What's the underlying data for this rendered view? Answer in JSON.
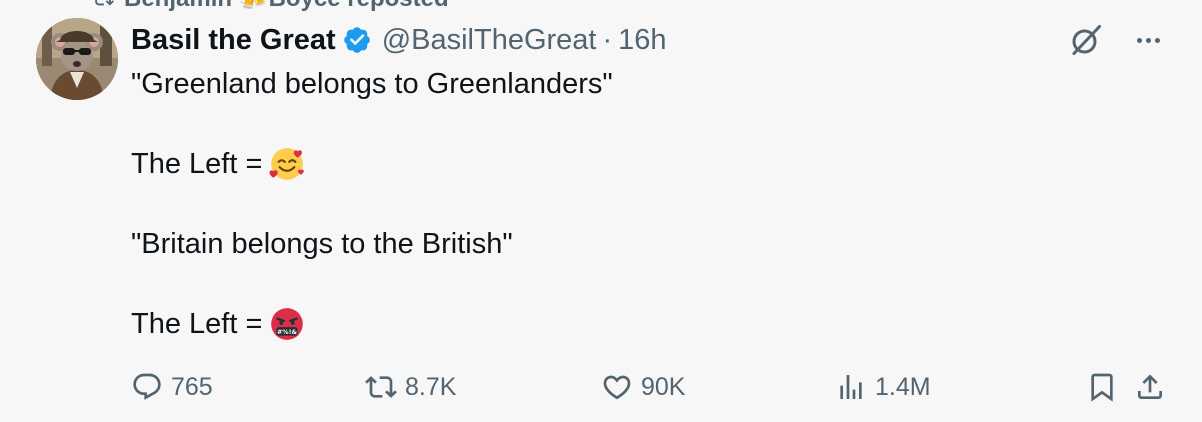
{
  "repost": {
    "text": "Benjamin 🍻Boyce reposted",
    "icon": "repost-icon"
  },
  "tweet": {
    "author_name": "Basil the Great",
    "handle": "@BasilTheGreat",
    "separator": "·",
    "time": "16h",
    "verified": true,
    "verified_color": "#1d9bf0",
    "lines": [
      "\"Greenland belongs to Greenlanders\"",
      "",
      "The Left =",
      "",
      "\"Britain belongs to the British\"",
      "",
      "The Left ="
    ],
    "emojis": [
      "smiling-face-with-hearts-emoji",
      "face-with-symbols-on-mouth-emoji"
    ]
  },
  "actions": {
    "replies": "765",
    "reposts": "8.7K",
    "likes": "90K",
    "views": "1.4M"
  },
  "colors": {
    "text": "#0f1419",
    "secondary": "#536471",
    "background": "#f7f7f7"
  }
}
